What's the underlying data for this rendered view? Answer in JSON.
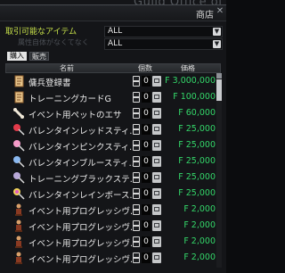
{
  "window": {
    "background_title": "Guild Office of",
    "title": "商店"
  },
  "filter": {
    "label": "取引可能なアイテム",
    "sublabel": "属性自体がなくてなく",
    "select1": "ALL",
    "select2": "ALL"
  },
  "tabs": {
    "buy": "購入",
    "sell": "販売"
  },
  "table": {
    "headers": {
      "name": "名前",
      "count": "個数",
      "price": "価格"
    },
    "rows": [
      {
        "name": "傭兵登録書",
        "qty": "0",
        "price": "F 3,000,000",
        "icon": "scroll-icon"
      },
      {
        "name": "トレーニングカードG",
        "qty": "0",
        "price": "F 100,000",
        "icon": "scroll-icon"
      },
      {
        "name": "イベント用ペットのエサ",
        "qty": "0",
        "price": "F 60,000",
        "icon": "bone-icon"
      },
      {
        "name": "バレンタインレッドスティ...",
        "qty": "0",
        "price": "F 25,000",
        "icon": "red-lollipop-icon"
      },
      {
        "name": "バレンタインピンクスティ...",
        "qty": "0",
        "price": "F 25,000",
        "icon": "pink-lollipop-icon"
      },
      {
        "name": "バレンタインブルースティ...",
        "qty": "0",
        "price": "F 25,000",
        "icon": "blue-lollipop-icon"
      },
      {
        "name": "トレーニングブラックステ...",
        "qty": "0",
        "price": "F 25,000",
        "icon": "black-lollipop-icon"
      },
      {
        "name": "バレンタインレインボース...",
        "qty": "0",
        "price": "F 25,000",
        "icon": "rainbow-lollipop-icon"
      },
      {
        "name": "イベント用プログレッシヴ...",
        "qty": "0",
        "price": "F 2,000",
        "icon": "figure-icon"
      },
      {
        "name": "イベント用プログレッシヴ...",
        "qty": "0",
        "price": "F 2,000",
        "icon": "figure-icon"
      },
      {
        "name": "イベント用プログレッシヴ...",
        "qty": "0",
        "price": "F 2,000",
        "icon": "figure-icon"
      },
      {
        "name": "イベント用プログレッシヴ...",
        "qty": "0",
        "price": "F 2,000",
        "icon": "figure-icon"
      }
    ]
  },
  "colors": {
    "price": "#34d86a",
    "filter_label": "#c8e24a"
  }
}
